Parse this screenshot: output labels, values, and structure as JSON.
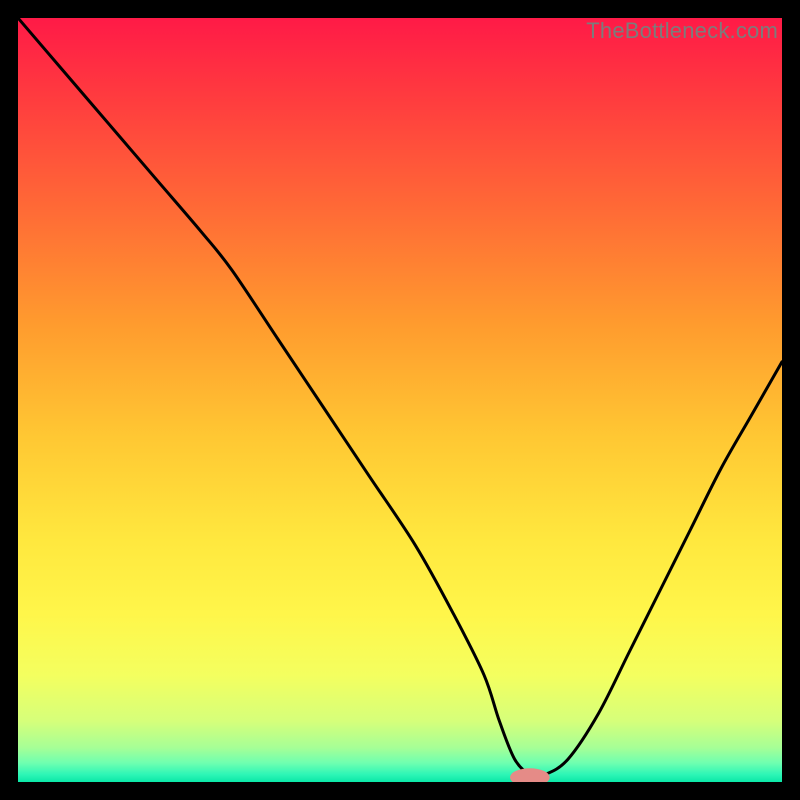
{
  "watermark": "TheBottleneck.com",
  "gradient": {
    "stops": [
      {
        "offset": 0.0,
        "color": "#ff1a47"
      },
      {
        "offset": 0.1,
        "color": "#ff3a3f"
      },
      {
        "offset": 0.25,
        "color": "#ff6a36"
      },
      {
        "offset": 0.4,
        "color": "#ff9b2e"
      },
      {
        "offset": 0.55,
        "color": "#ffc833"
      },
      {
        "offset": 0.68,
        "color": "#ffe73e"
      },
      {
        "offset": 0.78,
        "color": "#fff64a"
      },
      {
        "offset": 0.86,
        "color": "#f4ff5f"
      },
      {
        "offset": 0.92,
        "color": "#d6ff7a"
      },
      {
        "offset": 0.955,
        "color": "#a6ff96"
      },
      {
        "offset": 0.975,
        "color": "#6fffb0"
      },
      {
        "offset": 0.99,
        "color": "#2ef6b6"
      },
      {
        "offset": 1.0,
        "color": "#0be8a8"
      }
    ]
  },
  "chart_data": {
    "type": "line",
    "title": "",
    "xlabel": "",
    "ylabel": "",
    "xlim": [
      0,
      100
    ],
    "ylim": [
      0,
      100
    ],
    "grid": false,
    "series": [
      {
        "name": "bottleneck-curve",
        "x": [
          0,
          6,
          12,
          18,
          24,
          28,
          34,
          40,
          46,
          52,
          57,
          61,
          63,
          65,
          67,
          69,
          72,
          76,
          80,
          84,
          88,
          92,
          96,
          100
        ],
        "y": [
          100,
          93,
          86,
          79,
          72,
          67,
          58,
          49,
          40,
          31,
          22,
          14,
          8,
          3,
          1,
          1,
          3,
          9,
          17,
          25,
          33,
          41,
          48,
          55
        ]
      }
    ],
    "marker": {
      "name": "optimal-point",
      "x": 67,
      "y": 0.6,
      "rx": 2.6,
      "ry": 1.2,
      "color": "#e58b87"
    }
  }
}
